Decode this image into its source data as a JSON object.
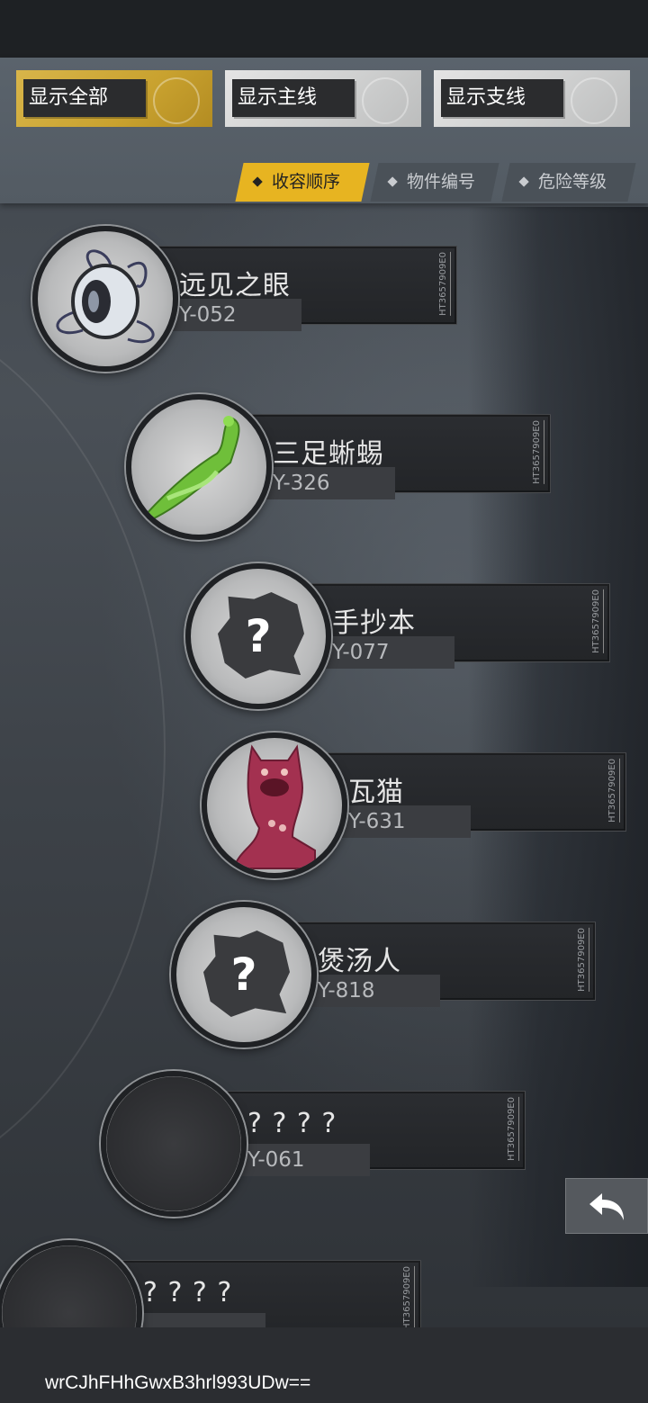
{
  "filters": [
    {
      "label": "显示全部",
      "active": true
    },
    {
      "label": "显示主线",
      "active": false
    },
    {
      "label": "显示支线",
      "active": false
    }
  ],
  "sort_tabs": [
    {
      "label": "收容顺序",
      "active": true
    },
    {
      "label": "物件编号",
      "active": false
    },
    {
      "label": "危险等级",
      "active": false
    }
  ],
  "entries": [
    {
      "name": "远见之眼",
      "code": "Y-052",
      "serial": "HT3657909E0",
      "icon": "eye-icon"
    },
    {
      "name": "三足蜥蜴",
      "code": "Y-326",
      "serial": "HT3657909E0",
      "icon": "jade-lizard-icon"
    },
    {
      "name": "手抄本",
      "code": "Y-077",
      "serial": "HT3657909E0",
      "icon": "unknown-question-icon",
      "unknown_mark": "?"
    },
    {
      "name": "瓦猫",
      "code": "Y-631",
      "serial": "HT3657909E0",
      "icon": "tile-cat-icon"
    },
    {
      "name": "煲汤人",
      "code": "Y-818",
      "serial": "HT3657909E0",
      "icon": "unknown-question-icon",
      "unknown_mark": "?"
    },
    {
      "name": "? ? ? ?",
      "code": "Y-061",
      "serial": "HT3657909E0",
      "icon": "locked-silhouette-icon"
    },
    {
      "name": "? ? ? ?",
      "code": "",
      "serial": "HT3657909E0",
      "icon": "locked-silhouette-icon"
    }
  ],
  "back_button_icon": "return-arrow-icon",
  "watermark": "wrCJhFHhGwxB3hrl993UDw==",
  "colors": {
    "accent_gold": "#e7b421",
    "header": "#5a636c",
    "plate": "#2b2d31"
  }
}
